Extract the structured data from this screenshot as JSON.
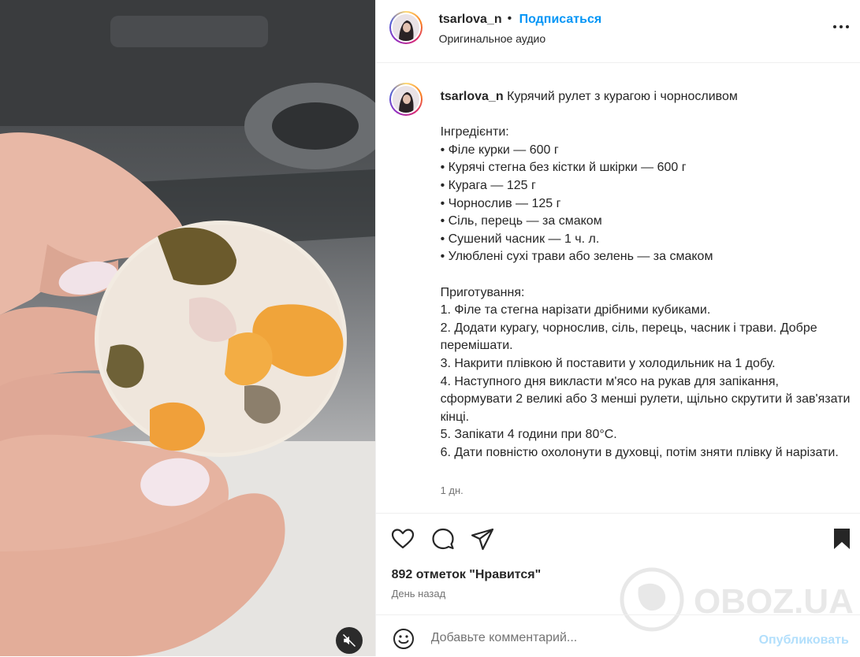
{
  "header": {
    "username": "tsarlova_n",
    "separator": "•",
    "follow_label": "Подписаться",
    "audio": "Оригинальное аудио",
    "more_icon": "more-horizontal-icon"
  },
  "caption": {
    "username": "tsarlova_n",
    "text": "Курячий рулет з курагою і чорносливом\n\nІнгредієнти:\n• Філе курки — 600 г\n• Курячі стегна без кістки й шкірки — 600 г\n• Курага — 125 г\n• Чорнослив — 125 г\n• Сіль, перець — за смаком\n• Сушений часник — 1 ч. л.\n• Улюблені сухі трави або зелень — за смаком\n\nПриготування:\n1. Філе та стегна нарізати дрібними кубиками.\n2. Додати курагу, чорнослив, сіль, перець, часник і трави. Добре перемішати.\n3. Накрити плівкою й поставити у холодильник на 1 добу.\n4. Наступного дня викласти м'ясо на рукав для запікання, сформувати 2 великі або 3 менші рулети, щільно скрутити й зав'язати кінці.\n5. Запікати 4 години при 80°С.\n6. Дати повністю охолонути в духовці, потім зняти плівку й нарізати.",
    "time_ago": "1 дн."
  },
  "actions": {
    "icons": [
      "heart-icon",
      "comment-icon",
      "share-icon",
      "bookmark-icon"
    ]
  },
  "likes_text": "892 отметок \"Нравится\"",
  "date_text": "День назад",
  "comment": {
    "placeholder": "Добавьте комментарий...",
    "publish_label": "Опубликовать"
  },
  "watermark": "OBOZ.UA",
  "media": {
    "mute_icon": "muted-icon"
  }
}
